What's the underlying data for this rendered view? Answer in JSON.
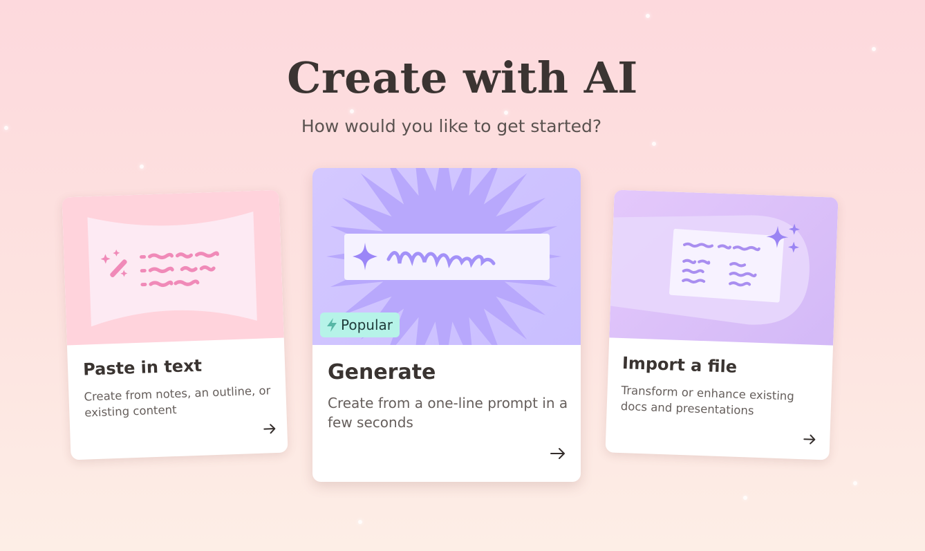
{
  "header": {
    "title": "Create with AI",
    "subtitle": "How would you like to get started?"
  },
  "cards": [
    {
      "id": "paste",
      "title": "Paste in text",
      "description": "Create from notes, an outline, or existing content",
      "icon": "magic-wand-icon"
    },
    {
      "id": "generate",
      "title": "Generate",
      "description": "Create from a one-line prompt in a few seconds",
      "badge": "Popular",
      "icon": "sparkle-icon"
    },
    {
      "id": "import",
      "title": "Import a file",
      "description": "Transform or enhance existing docs and presentations",
      "icon": "sparkles-icon"
    }
  ],
  "colors": {
    "background_top": "#fdd9dd",
    "background_bottom": "#fdeee6",
    "paste_accent": "#ffd3dc",
    "generate_accent": "#c9beff",
    "import_accent": "#dcc1fa",
    "badge_background": "#b6f3e8"
  }
}
